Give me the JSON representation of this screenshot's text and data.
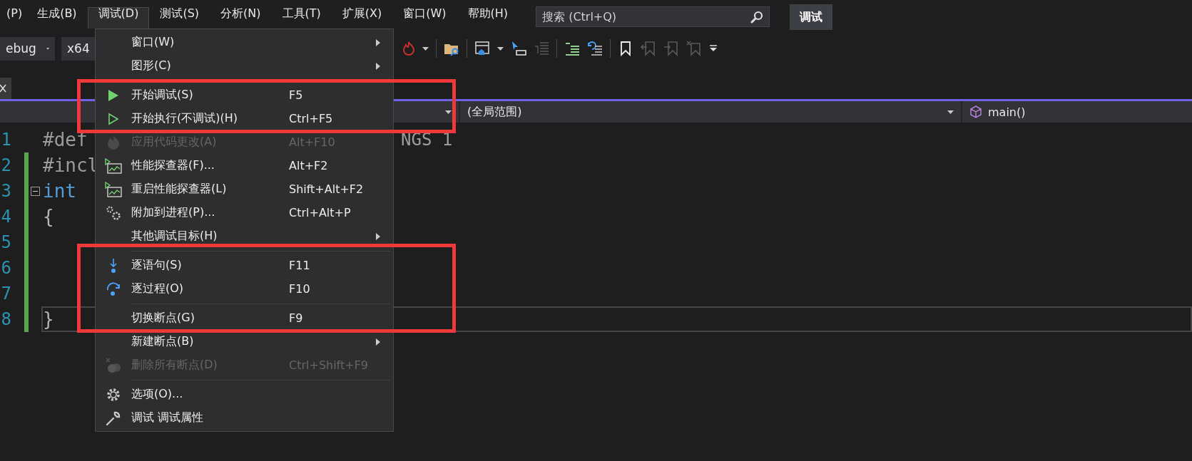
{
  "menu_bar": {
    "items": [
      {
        "label": "(P)",
        "selected": false
      },
      {
        "label": "生成(B)",
        "selected": false
      },
      {
        "label": "调试(D)",
        "selected": true
      },
      {
        "label": "测试(S)",
        "selected": false
      },
      {
        "label": "分析(N)",
        "selected": false
      },
      {
        "label": "工具(T)",
        "selected": false
      },
      {
        "label": "扩展(X)",
        "selected": false
      },
      {
        "label": "窗口(W)",
        "selected": false
      },
      {
        "label": "帮助(H)",
        "selected": false
      }
    ]
  },
  "search": {
    "placeholder": "搜索 (Ctrl+Q)"
  },
  "mode_badge": "调试",
  "toolbar": {
    "configuration": "ebug",
    "platform": "x64"
  },
  "navigation_bar": {
    "scope": "(全局范围)",
    "member": "main()"
  },
  "editor": {
    "lines": [
      {
        "number": "1",
        "changed": false,
        "foldable": false,
        "current": false,
        "code": [
          {
            "kind": "directive",
            "text": "#def"
          }
        ],
        "tail": [
          {
            "kind": "directive",
            "text": "NGS 1"
          }
        ]
      },
      {
        "number": "2",
        "changed": true,
        "foldable": false,
        "current": false,
        "code": [
          {
            "kind": "directive",
            "text": "#incl"
          }
        ]
      },
      {
        "number": "3",
        "changed": true,
        "foldable": true,
        "current": false,
        "code": [
          {
            "kind": "keyword",
            "text": "int"
          }
        ]
      },
      {
        "number": "4",
        "changed": true,
        "foldable": false,
        "current": false,
        "code": [
          {
            "kind": "plain",
            "text": "{"
          }
        ]
      },
      {
        "number": "5",
        "changed": true,
        "foldable": false,
        "current": false
      },
      {
        "number": "6",
        "changed": true,
        "foldable": false,
        "current": false
      },
      {
        "number": "7",
        "changed": true,
        "foldable": false,
        "current": false
      },
      {
        "number": "8",
        "changed": true,
        "foldable": false,
        "current": true,
        "code": [
          {
            "kind": "plain",
            "text": "}"
          }
        ]
      }
    ]
  },
  "debug_menu": {
    "entries": [
      {
        "kind": "item",
        "label": "窗口(W)",
        "submenu": true,
        "disabled": false
      },
      {
        "kind": "item",
        "label": "图形(C)",
        "submenu": true,
        "disabled": false
      },
      {
        "kind": "separator"
      },
      {
        "kind": "annotation",
        "entries": [
          {
            "kind": "item",
            "label": "开始调试(S)",
            "shortcut": "F5",
            "submenu": false,
            "disabled": false
          },
          {
            "kind": "item",
            "label": "开始执行(不调试)(H)",
            "shortcut": "Ctrl+F5",
            "submenu": false,
            "disabled": false
          }
        ]
      },
      {
        "kind": "item",
        "label": "应用代码更改(A)",
        "shortcut": "Alt+F10",
        "submenu": false,
        "disabled": true
      },
      {
        "kind": "item",
        "label": "性能探查器(F)...",
        "shortcut": "Alt+F2",
        "submenu": false,
        "disabled": false
      },
      {
        "kind": "item",
        "label": "重启性能探查器(L)",
        "shortcut": "Shift+Alt+F2",
        "submenu": false,
        "disabled": false
      },
      {
        "kind": "item",
        "label": "附加到进程(P)...",
        "shortcut": "Ctrl+Alt+P",
        "submenu": false,
        "disabled": false
      },
      {
        "kind": "item",
        "label": "其他调试目标(H)",
        "submenu": true,
        "disabled": false
      },
      {
        "kind": "annotation",
        "entries": [
          {
            "kind": "separator"
          },
          {
            "kind": "item",
            "label": "逐语句(S)",
            "shortcut": "F11",
            "submenu": false,
            "disabled": false
          },
          {
            "kind": "item",
            "label": "逐过程(O)",
            "shortcut": "F10",
            "submenu": false,
            "disabled": false
          },
          {
            "kind": "separator"
          },
          {
            "kind": "item",
            "label": "切换断点(G)",
            "shortcut": "F9",
            "submenu": false,
            "disabled": false
          }
        ]
      },
      {
        "kind": "item",
        "label": "新建断点(B)",
        "submenu": true,
        "disabled": false
      },
      {
        "kind": "item",
        "label": "删除所有断点(D)",
        "shortcut": "Ctrl+Shift+F9",
        "submenu": false,
        "disabled": true
      },
      {
        "kind": "separator"
      },
      {
        "kind": "item",
        "label": "选项(O)...",
        "submenu": false,
        "disabled": false
      },
      {
        "kind": "item",
        "label": "调试 调试属性",
        "submenu": false,
        "disabled": false
      }
    ]
  }
}
